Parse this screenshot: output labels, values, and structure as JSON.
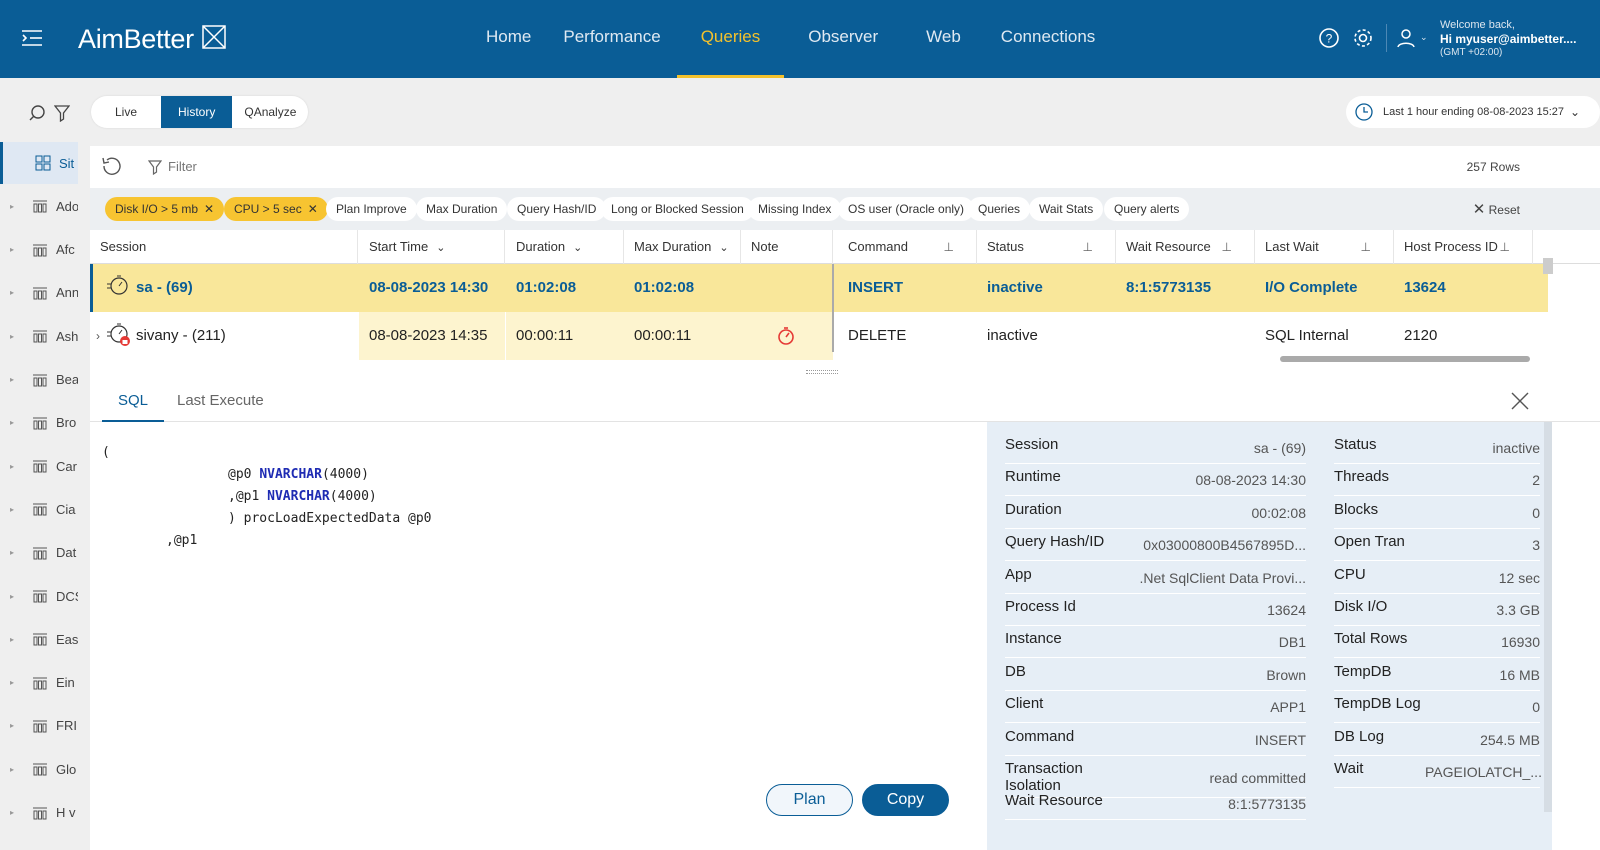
{
  "brand": {
    "name": "AimBetter"
  },
  "nav": [
    "Home",
    "Performance",
    "Queries",
    "Observer",
    "Web",
    "Connections"
  ],
  "user": {
    "welcome": "Welcome back,",
    "name": "Hi myuser@aimbetter....",
    "tz": "(GMT +02:00)"
  },
  "sidebar": [
    {
      "label": "Sit",
      "active": true
    },
    {
      "label": "Ado"
    },
    {
      "label": "Afc"
    },
    {
      "label": "Ann"
    },
    {
      "label": "Ash"
    },
    {
      "label": "Bea"
    },
    {
      "label": "Bro"
    },
    {
      "label": "Car"
    },
    {
      "label": "Cia"
    },
    {
      "label": "Dat"
    },
    {
      "label": "DCS"
    },
    {
      "label": "Eas"
    },
    {
      "label": "Ein"
    },
    {
      "label": "FRI"
    },
    {
      "label": "Glo"
    },
    {
      "label": "H v"
    }
  ],
  "mode_tabs": {
    "live": "Live",
    "history": "History",
    "qanalyze": "QAnalyze"
  },
  "time_range": "Last 1 hour ending  08-08-2023 15:27",
  "filter": {
    "label": "Filter",
    "rows": "257 Rows",
    "reset": "Reset"
  },
  "chips": [
    {
      "label": "Disk I/O > 5 mb",
      "active": true
    },
    {
      "label": "CPU > 5 sec",
      "active": true
    },
    {
      "label": "Plan Improve"
    },
    {
      "label": "Max Duration"
    },
    {
      "label": "Query Hash/ID"
    },
    {
      "label": "Long or Blocked Session"
    },
    {
      "label": "Missing Index"
    },
    {
      "label": "OS user (Oracle only)"
    },
    {
      "label": "Queries"
    },
    {
      "label": "Wait Stats"
    },
    {
      "label": "Query alerts"
    }
  ],
  "columns": [
    "Session",
    "Start Time",
    "Duration",
    "Max Duration",
    "Note",
    "Command",
    "Status",
    "Wait Resource",
    "Last Wait",
    "Host Process ID"
  ],
  "rows": [
    {
      "session": "sa - (69)",
      "start": "08-08-2023 14:30",
      "duration": "01:02:08",
      "max": "01:02:08",
      "command": "INSERT",
      "status": "inactive",
      "wait_resource": "8:1:5773135",
      "last_wait": "I/O Complete",
      "host_pid": "13624"
    },
    {
      "session": "sivany - (211)",
      "start": "08-08-2023 14:35",
      "duration": "00:00:11",
      "max": "00:00:11",
      "command": "DELETE",
      "status": "inactive",
      "wait_resource": "",
      "last_wait": "SQL Internal",
      "host_pid": "2120"
    }
  ],
  "detail_tabs": {
    "sql": "SQL",
    "last_execute": "Last Execute"
  },
  "sql": {
    "l1": "(",
    "l2a": "@p0 ",
    "l2b": "NVARCHAR",
    "l2c": "(4000)",
    "l3a": ",@p1 ",
    "l3b": "NVARCHAR",
    "l3c": "(4000)",
    "l4": ") procLoadExpectedData @p0",
    "l5": ",@p1"
  },
  "buttons": {
    "plan": "Plan",
    "copy": "Copy"
  },
  "details_left": [
    {
      "k": "Session",
      "v": "sa - (69)"
    },
    {
      "k": "Runtime",
      "v": "08-08-2023 14:30"
    },
    {
      "k": "Duration",
      "v": "00:02:08"
    },
    {
      "k": "Query Hash/ID",
      "v": "0x03000800B4567895D..."
    },
    {
      "k": "App",
      "v": ".Net SqlClient Data Provi..."
    },
    {
      "k": "Process Id",
      "v": "13624"
    },
    {
      "k": "Instance",
      "v": "DB1"
    },
    {
      "k": "DB",
      "v": "Brown"
    },
    {
      "k": "Client",
      "v": "APP1"
    },
    {
      "k": "Command",
      "v": "INSERT"
    },
    {
      "k": "Transaction Isolation",
      "v": "read committed"
    },
    {
      "k": "Wait Resource",
      "v": "8:1:5773135"
    }
  ],
  "details_right": [
    {
      "k": "Status",
      "v": "inactive"
    },
    {
      "k": "Threads",
      "v": "2"
    },
    {
      "k": "Blocks",
      "v": "0"
    },
    {
      "k": "Open Tran",
      "v": "3"
    },
    {
      "k": "CPU",
      "v": "12 sec"
    },
    {
      "k": "Disk I/O",
      "v": "3.3 GB"
    },
    {
      "k": "Total Rows",
      "v": "16930"
    },
    {
      "k": "TempDB",
      "v": "16 MB"
    },
    {
      "k": "TempDB Log",
      "v": "0"
    },
    {
      "k": "DB Log",
      "v": "254.5 MB"
    },
    {
      "k": "Wait",
      "v": "PAGEIOLATCH_..."
    }
  ],
  "colors": {
    "brand": "#0a5d96",
    "accent": "#f3c12c",
    "chip_active": "#f7c431",
    "row_selected": "#f9e79a"
  }
}
